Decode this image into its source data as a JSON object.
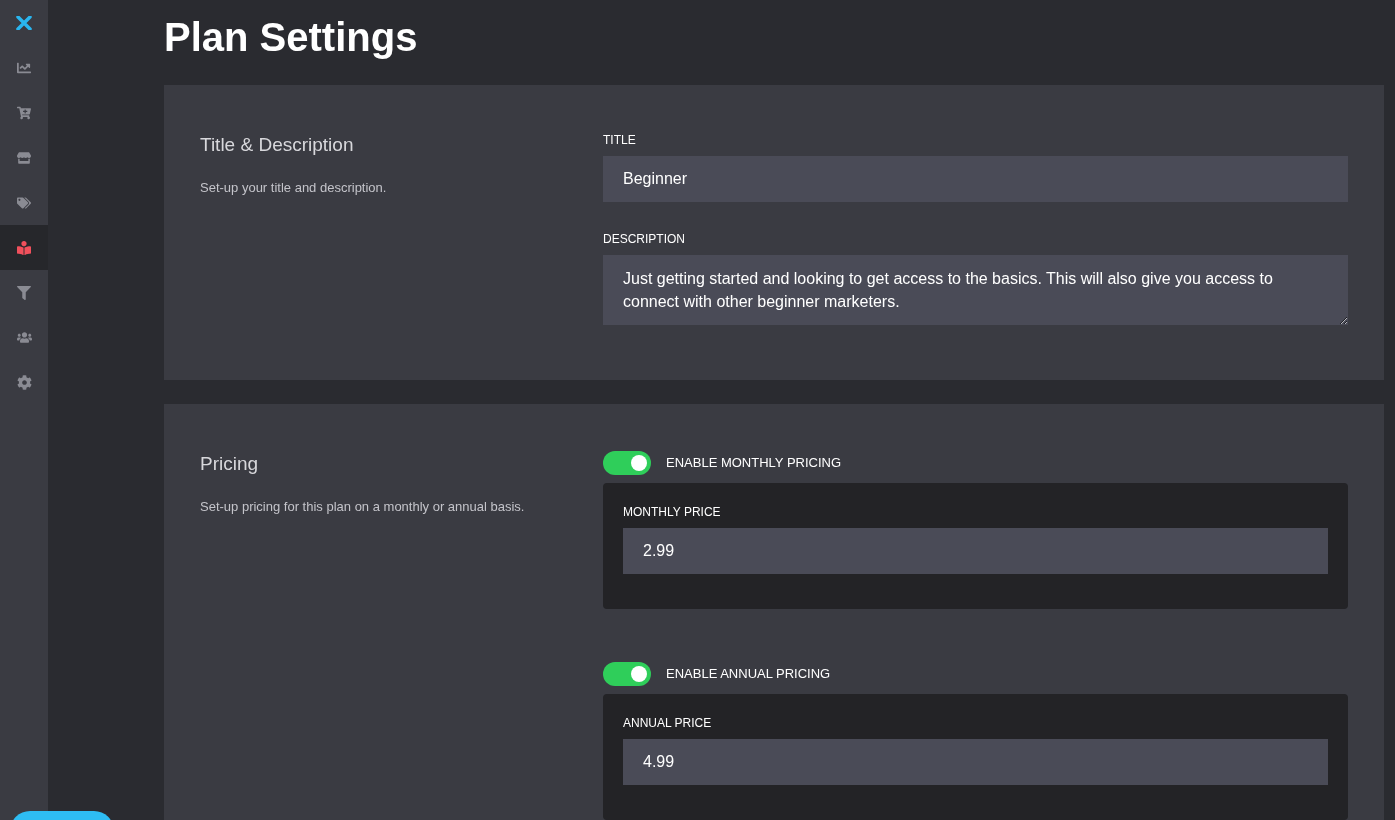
{
  "sidebar": {
    "items": [
      {
        "kind": "logo",
        "selected": false
      },
      {
        "kind": "chart",
        "selected": false
      },
      {
        "kind": "cart",
        "selected": false
      },
      {
        "kind": "store",
        "selected": false
      },
      {
        "kind": "tags",
        "selected": false
      },
      {
        "kind": "reader",
        "selected": true
      },
      {
        "kind": "filter",
        "selected": false
      },
      {
        "kind": "users",
        "selected": false
      },
      {
        "kind": "settings",
        "selected": false
      }
    ]
  },
  "page_title": "Plan Settings",
  "title_section": {
    "heading": "Title & Description",
    "description": "Set-up your title and description.",
    "fields": [
      {
        "kind": "input",
        "label": "TITLE",
        "value": "Beginner"
      },
      {
        "kind": "textarea",
        "label": "DESCRIPTION",
        "value": "Just getting started and looking to get access to the basics. This will also give you access to connect with other beginner marketers."
      }
    ]
  },
  "pricing_section": {
    "heading": "Pricing",
    "description": "Set-up pricing for this plan on a monthly or annual basis.",
    "options": [
      {
        "toggle_label": "ENABLE MONTHLY PRICING",
        "on": true,
        "price_label": "MONTHLY PRICE",
        "value": "2.99"
      },
      {
        "toggle_label": "ENABLE ANNUAL PRICING",
        "on": true,
        "price_label": "ANNUAL PRICE",
        "value": "4.99"
      }
    ]
  }
}
